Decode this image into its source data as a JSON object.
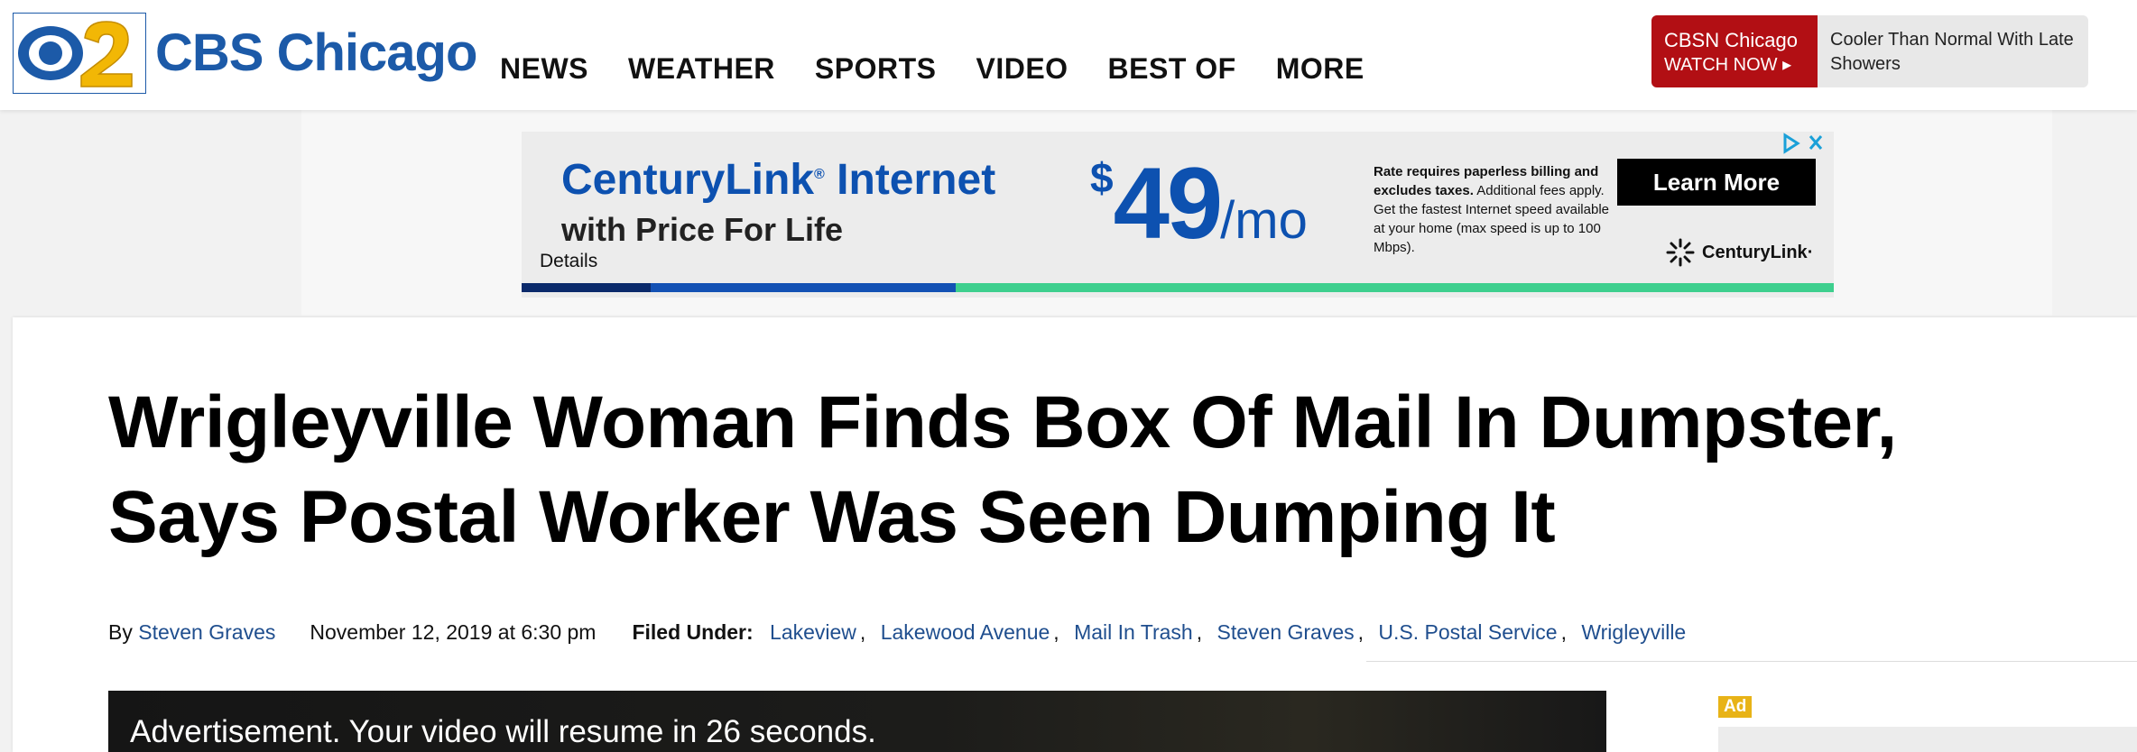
{
  "header": {
    "logo_text": "CBS Chicago",
    "nav": [
      {
        "label": "NEWS"
      },
      {
        "label": "WEATHER"
      },
      {
        "label": "SPORTS"
      },
      {
        "label": "VIDEO"
      },
      {
        "label": "BEST OF"
      },
      {
        "label": "MORE"
      }
    ],
    "live": {
      "station": "CBSN Chicago",
      "watch_now": "WATCH NOW ▸",
      "weather": "Cooler Than Normal With Late Showers"
    }
  },
  "ad": {
    "brand": "CenturyLink",
    "brand_suffix": " Internet",
    "registered": "®",
    "subline": "with Price For Life",
    "details": "Details",
    "price_dollar": "$",
    "price_value": "49",
    "price_unit": "/mo",
    "fine_bold": "Rate requires paperless billing and excludes taxes.",
    "fine_rest": " Additional fees apply. Get the fastest Internet speed available at your home (max speed is up to 100 Mbps).",
    "cta": "Learn More",
    "logo_text": "CenturyLink",
    "logo_suffix": "·",
    "stripe_colors": [
      "#0b2a6b",
      "#1351b4",
      "#3ecf8e"
    ]
  },
  "article": {
    "headline": "Wrigleyville Woman Finds Box Of Mail In Dumpster, Says Postal Worker Was Seen Dumping It",
    "by_prefix": "By ",
    "author": "Steven Graves",
    "date": "November 12, 2019 at 6:30 pm",
    "filed_label": "Filed Under:",
    "tags": [
      "Lakeview",
      "Lakewood Avenue",
      "Mail In Trash",
      "Steven Graves",
      "U.S. Postal Service",
      "Wrigleyville"
    ],
    "video_message": "Advertisement. Your video will resume in 26 seconds.",
    "ad_label": "Ad"
  },
  "colors": {
    "brand_blue": "#1c5aa8",
    "live_red": "#b20f14",
    "link_blue": "#1f4e8e",
    "ad_yellow": "#e8b317"
  }
}
